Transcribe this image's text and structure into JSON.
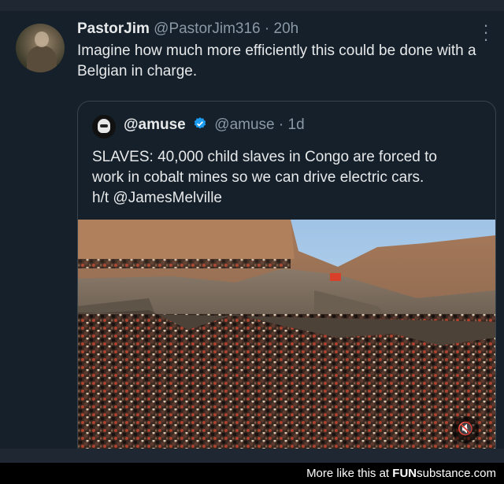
{
  "tweet": {
    "display_name": "PastorJim",
    "handle": "@PastorJim316",
    "separator": "·",
    "time": "20h",
    "text": "Imagine how much more efficiently this could be done with a Belgian in charge."
  },
  "quote": {
    "display_name": "@amuse",
    "handle": "@amuse",
    "separator": "·",
    "time": "1d",
    "text_line1": "SLAVES: 40,000 child slaves in Congo are forced to",
    "text_line2": "work in cobalt mines so we can drive electric cars.",
    "text_line3": "h/t @JamesMelville",
    "media_icon": "mute-icon"
  },
  "footer": {
    "prefix": "More like this at ",
    "brand_bold": "FUN",
    "brand_rest": "substance.com"
  },
  "colors": {
    "background": "#15202b",
    "text": "#e7e9ea",
    "muted": "#8b98a5",
    "verified": "#1d9bf0"
  }
}
